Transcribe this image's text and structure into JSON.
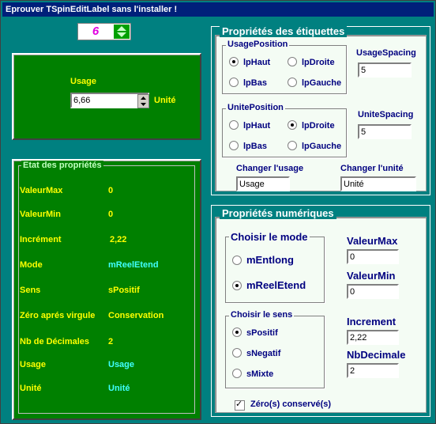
{
  "window": {
    "title": "Eprouver  TSpinEditLabel sans l'installer !"
  },
  "top_spin": {
    "value": "6"
  },
  "demo": {
    "usage_label": "Usage",
    "value": "6,66",
    "unit_label": "Unité"
  },
  "etat": {
    "title": "Etat des propriétés",
    "rows": [
      {
        "label": "ValeurMax",
        "value": "0"
      },
      {
        "label": "ValeurMin",
        "value": "0"
      },
      {
        "label": "Incrément",
        "value": "2,22"
      },
      {
        "label": "Mode",
        "value": "mReelEtend"
      },
      {
        "label": "Sens",
        "value": "sPositif"
      },
      {
        "label": "Zéro aprés virgule",
        "value": "Conservation"
      },
      {
        "label": "Nb de Décimales",
        "value": "2"
      },
      {
        "label": "Usage",
        "value": "Usage"
      },
      {
        "label": "Unité",
        "value": "Unité"
      }
    ]
  },
  "etiquettes": {
    "title": "Propriétés des étiquettes",
    "usage_position": {
      "title": "UsagePosition",
      "options": [
        "lpHaut",
        "lpDroite",
        "lpBas",
        "lpGauche"
      ],
      "selected": "lpHaut"
    },
    "usage_spacing": {
      "label": "UsageSpacing",
      "value": "5"
    },
    "unite_position": {
      "title": "UnitePosition",
      "options": [
        "lpHaut",
        "lpDroite",
        "lpBas",
        "lpGauche"
      ],
      "selected": "lpDroite"
    },
    "unite_spacing": {
      "label": "UniteSpacing",
      "value": "5"
    },
    "changer_usage": {
      "label": "Changer l'usage",
      "value": "Usage"
    },
    "changer_unite": {
      "label": "Changer l'unité",
      "value": "Unité"
    }
  },
  "numeriques": {
    "title": "Propriétés numériques",
    "mode": {
      "title": "Choisir le mode",
      "options": [
        "mEntlong",
        "mReelEtend"
      ],
      "selected": "mReelEtend"
    },
    "sens": {
      "title": "Choisir le sens",
      "options": [
        "sPositif",
        "sNegatif",
        "sMixte"
      ],
      "selected": "sPositif"
    },
    "valeur_max": {
      "label": "ValeurMax",
      "value": "0"
    },
    "valeur_min": {
      "label": "ValeurMin",
      "value": "0"
    },
    "increment": {
      "label": "Increment",
      "value": "2,22"
    },
    "nb_decimale": {
      "label": "NbDecimale",
      "value": "2"
    },
    "zero_conserve": {
      "label": "Zéro(s) conservé(s)",
      "checked": true
    }
  }
}
